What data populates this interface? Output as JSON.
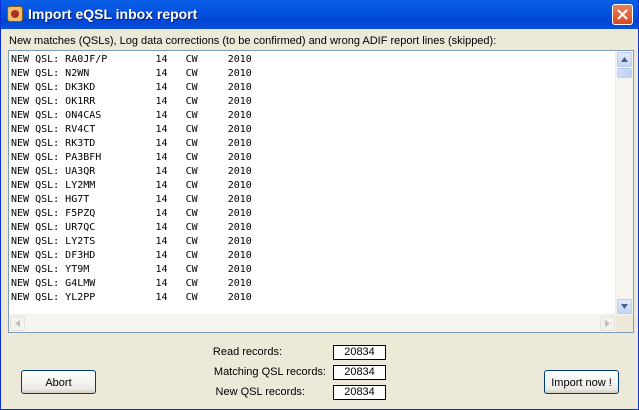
{
  "window": {
    "title": "Import eQSL inbox report"
  },
  "caption": "New matches (QSLs), Log data corrections (to be confirmed) and wrong ADIF report lines (skipped):",
  "report_lines": [
    "NEW QSL: RA0JF/P        14   CW     2010",
    "NEW QSL: N2WN           14   CW     2010",
    "NEW QSL: DK3KD          14   CW     2010",
    "NEW QSL: OK1RR          14   CW     2010",
    "NEW QSL: ON4CAS         14   CW     2010",
    "NEW QSL: RV4CT          14   CW     2010",
    "NEW QSL: RK3TD          14   CW     2010",
    "NEW QSL: PA3BFH         14   CW     2010",
    "NEW QSL: UA3QR          14   CW     2010",
    "NEW QSL: LY2MM          14   CW     2010",
    "NEW QSL: HG7T           14   CW     2010",
    "NEW QSL: F5PZQ          14   CW     2010",
    "NEW QSL: UR7QC          14   CW     2010",
    "NEW QSL: LY2TS          14   CW     2010",
    "NEW QSL: DF3HD          14   CW     2010",
    "NEW QSL: YT9M           14   CW     2010",
    "NEW QSL: G4LMW          14   CW     2010",
    "NEW QSL: YL2PP          14   CW     2010"
  ],
  "stats": {
    "read_label": "Read records:",
    "read_value": "20834",
    "matching_label": "Matching QSL records:",
    "matching_value": "20834",
    "new_label": "New QSL records:",
    "new_value": "20834"
  },
  "buttons": {
    "abort": "Abort",
    "import": "Import now !"
  },
  "icons": {
    "app": "qsl-card-icon",
    "close": "close-icon",
    "scroll_up": "arrow-up-icon",
    "scroll_down": "arrow-down-icon",
    "scroll_left": "arrow-left-icon",
    "scroll_right": "arrow-right-icon"
  },
  "colors": {
    "titlebar": "#0453e0",
    "close_button": "#d64a20",
    "dialog": "#ece9d8"
  }
}
